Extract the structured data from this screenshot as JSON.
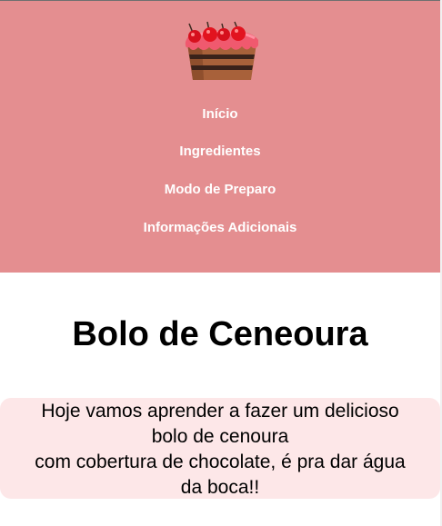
{
  "nav": {
    "items": [
      {
        "label": "Início"
      },
      {
        "label": "Ingredientes"
      },
      {
        "label": "Modo de Preparo"
      },
      {
        "label": "Informações Adicionais"
      }
    ]
  },
  "logo": {
    "icon": "cake-slice-with-cherries-icon"
  },
  "main": {
    "title": "Bolo de Ceneoura",
    "intro": [
      "Hoje vamos aprender a fazer um delicioso",
      "bolo de cenoura",
      "com cobertura de chocolate, é pra dar água",
      "da boca!!"
    ]
  },
  "colors": {
    "header_bg": "#e48e90",
    "intro_bg": "#fde7e8",
    "nav_text": "#ffffff"
  }
}
